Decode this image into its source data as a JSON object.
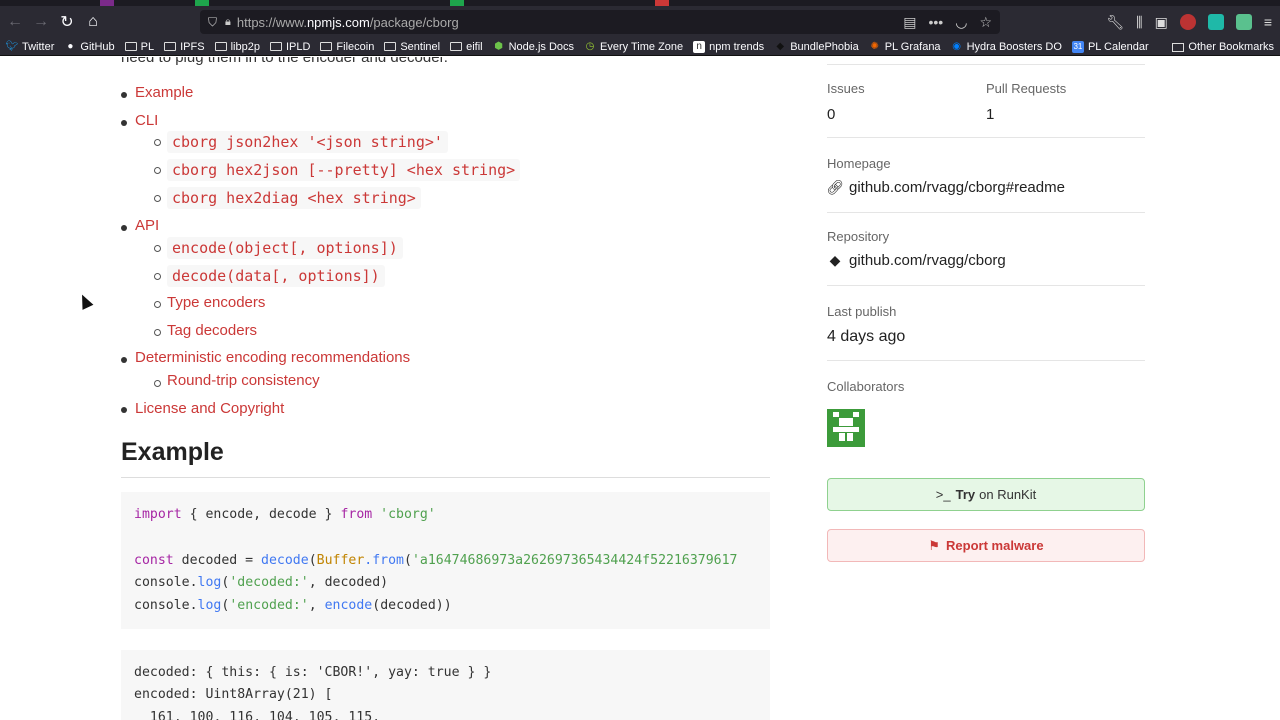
{
  "browser": {
    "url_prefix": "https://www.",
    "url_host": "npmjs.com",
    "url_path": "/package/cborg",
    "bookmarks": [
      {
        "label": "Twitter",
        "icon": "twitter-icon"
      },
      {
        "label": "GitHub",
        "icon": "github-icon"
      },
      {
        "label": "PL",
        "icon": "folder-icon"
      },
      {
        "label": "IPFS",
        "icon": "folder-icon"
      },
      {
        "label": "libp2p",
        "icon": "folder-icon"
      },
      {
        "label": "IPLD",
        "icon": "folder-icon"
      },
      {
        "label": "Filecoin",
        "icon": "folder-icon"
      },
      {
        "label": "Sentinel",
        "icon": "folder-icon"
      },
      {
        "label": "eifil",
        "icon": "folder-icon"
      },
      {
        "label": "Node.js Docs",
        "icon": "nodejs-icon"
      },
      {
        "label": "Every Time Zone",
        "icon": "clock-icon"
      },
      {
        "label": "npm trends",
        "icon": "npm-icon"
      },
      {
        "label": "BundlePhobia",
        "icon": "bundlephobia-icon"
      },
      {
        "label": "PL Grafana",
        "icon": "grafana-icon"
      },
      {
        "label": "Hydra Boosters DO",
        "icon": "digitalocean-icon"
      },
      {
        "label": "PL Calendar",
        "icon": "calendar-icon"
      }
    ],
    "other_bookmarks": "Other Bookmarks"
  },
  "content": {
    "cutoff_text": "need to plug them in to the encoder and decoder.",
    "toc": {
      "example": "Example",
      "cli": "CLI",
      "cli_items": [
        "cborg json2hex '<json string>'",
        "cborg hex2json [--pretty] <hex string>",
        "cborg hex2diag <hex string>"
      ],
      "api": "API",
      "api_code_items": [
        "encode(object[, options])",
        "decode(data[, options])"
      ],
      "api_link_items": [
        "Type encoders",
        "Tag decoders"
      ],
      "deterministic": "Deterministic encoding recommendations",
      "roundtrip": "Round-trip consistency",
      "license": "License and Copyright"
    },
    "heading": "Example",
    "code": {
      "import_kw": "import",
      "import_mid": " { encode, decode } ",
      "from_kw": "from",
      "import_str": "'cborg'",
      "const_kw": "const",
      "decoded_var": " decoded = ",
      "decode_fn": "decode",
      "buffer_cls": "Buffer",
      "from_fn": ".from",
      "hex_str": "'a16474686973a262697365434424f52216379617",
      "log1_prefix": "console.",
      "log_fn": "log",
      "log1_str": "'decoded:'",
      "log1_rest": ", decoded)",
      "log2_str": "'encoded:'",
      "encode_fn": "encode",
      "log2_rest": "(decoded))"
    },
    "output": {
      "line1": "decoded: { this: { is: 'CBOR!', yay: true } }",
      "line2": "encoded: Uint8Array(21) [",
      "line3": "  161, 100, 116, 104, 105, 115,"
    }
  },
  "sidebar": {
    "issues_label": "Issues",
    "issues_value": "0",
    "prs_label": "Pull Requests",
    "prs_value": "1",
    "homepage_label": "Homepage",
    "homepage_value": "github.com/rvagg/cborg#readme",
    "repository_label": "Repository",
    "repository_value": "github.com/rvagg/cborg",
    "last_publish_label": "Last publish",
    "last_publish_value": "4 days ago",
    "collaborators_label": "Collaborators",
    "runkit_try": "Try",
    "runkit_rest": "on RunKit",
    "report_label": "Report malware"
  },
  "colors": {
    "npm_red": "#cb3837",
    "chrome_dark": "#2b2a33"
  }
}
